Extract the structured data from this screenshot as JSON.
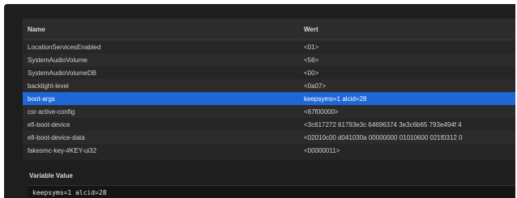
{
  "table": {
    "headers": {
      "name": "Name",
      "value": "Wert"
    },
    "rows": [
      {
        "name": "LocationServicesEnabled",
        "value": "<01>"
      },
      {
        "name": "SystemAudioVolume",
        "value": "<56>"
      },
      {
        "name": "SystemAudioVolumeDB",
        "value": "<00>"
      },
      {
        "name": "backlight-level",
        "value": "<0a07>"
      },
      {
        "name": "boot-args",
        "value": "keepsyms=1 alcid=28",
        "selected": true
      },
      {
        "name": "csr-active-config",
        "value": "<67f00000>"
      },
      {
        "name": "efi-boot-device",
        "value": "<3c617272 61793e3c 64696374 3e3c6b65 793e494f 4"
      },
      {
        "name": "efi-boot-device-data",
        "value": "<02010c00 d041030a 00000000 01010600 021f0312 0"
      },
      {
        "name": "fakesmc-key-#KEY-ui32",
        "value": "<00000011>"
      }
    ]
  },
  "variable_value": {
    "label": "Variable Value",
    "text": "keepsyms=1 alcid=28"
  },
  "colors": {
    "selection": "#1f66d6",
    "background": "#1e1e1e"
  }
}
